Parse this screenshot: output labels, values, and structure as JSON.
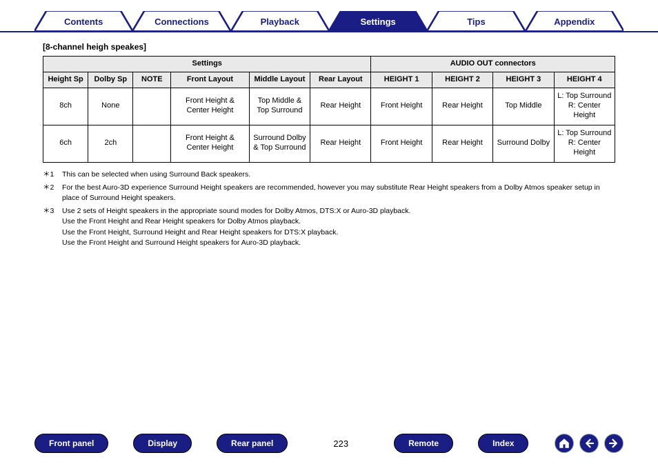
{
  "tabs": {
    "contents": "Contents",
    "connections": "Connections",
    "playback": "Playback",
    "settings": "Settings",
    "tips": "Tips",
    "appendix": "Appendix"
  },
  "section_title": "[8-channel heigh speakes]",
  "table": {
    "group_settings": "Settings",
    "group_audio_out": "AUDIO OUT connectors",
    "headers": {
      "height_sp": "Height Sp",
      "dolby_sp": "Dolby Sp",
      "note": "NOTE",
      "front_layout": "Front Layout",
      "middle_layout": "Middle Layout",
      "rear_layout": "Rear Layout",
      "h1": "HEIGHT 1",
      "h2": "HEIGHT 2",
      "h3": "HEIGHT 3",
      "h4": "HEIGHT 4"
    },
    "rows": [
      {
        "height_sp": "8ch",
        "dolby_sp": "None",
        "note": "",
        "front_layout": "Front Height & Center Height",
        "middle_layout": "Top Middle & Top Surround",
        "rear_layout": "Rear Height",
        "h1": "Front Height",
        "h2": "Rear Height",
        "h3": "Top Middle",
        "h4": "L: Top Surround R: Center Height"
      },
      {
        "height_sp": "6ch",
        "dolby_sp": "2ch",
        "note": "",
        "front_layout": "Front Height & Center Height",
        "middle_layout": "Surround Dolby & Top Surround",
        "rear_layout": "Rear Height",
        "h1": "Front Height",
        "h2": "Rear Height",
        "h3": "Surround Dolby",
        "h4": "L: Top Surround R: Center Height"
      }
    ]
  },
  "footnotes": {
    "m1": "＊1",
    "m2": "＊2",
    "m3": "＊3",
    "n1": "This can be selected when using Surround Back speakers.",
    "n2": "For the best Auro-3D experience Surround Height speakers are recommended, however you may substitute Rear Height speakers from a Dolby Atmos speaker setup in place of Surround Height speakers.",
    "n3a": "Use 2 sets of Height speakers in the appropriate sound modes for Dolby Atmos, DTS:X or Auro-3D playback.",
    "n3b": "Use the Front Height and Rear Height speakers for Dolby Atmos playback.",
    "n3c": "Use the Front Height, Surround Height and Rear Height speakers for DTS:X playback.",
    "n3d": "Use the Front Height and Surround Height speakers for Auro-3D playback."
  },
  "bottom": {
    "front_panel": "Front panel",
    "display": "Display",
    "rear_panel": "Rear panel",
    "page": "223",
    "remote": "Remote",
    "index": "Index"
  },
  "icons": {
    "home": "home-icon",
    "prev": "arrow-left-icon",
    "next": "arrow-right-icon"
  },
  "colors": {
    "brand": "#1a1e84"
  }
}
